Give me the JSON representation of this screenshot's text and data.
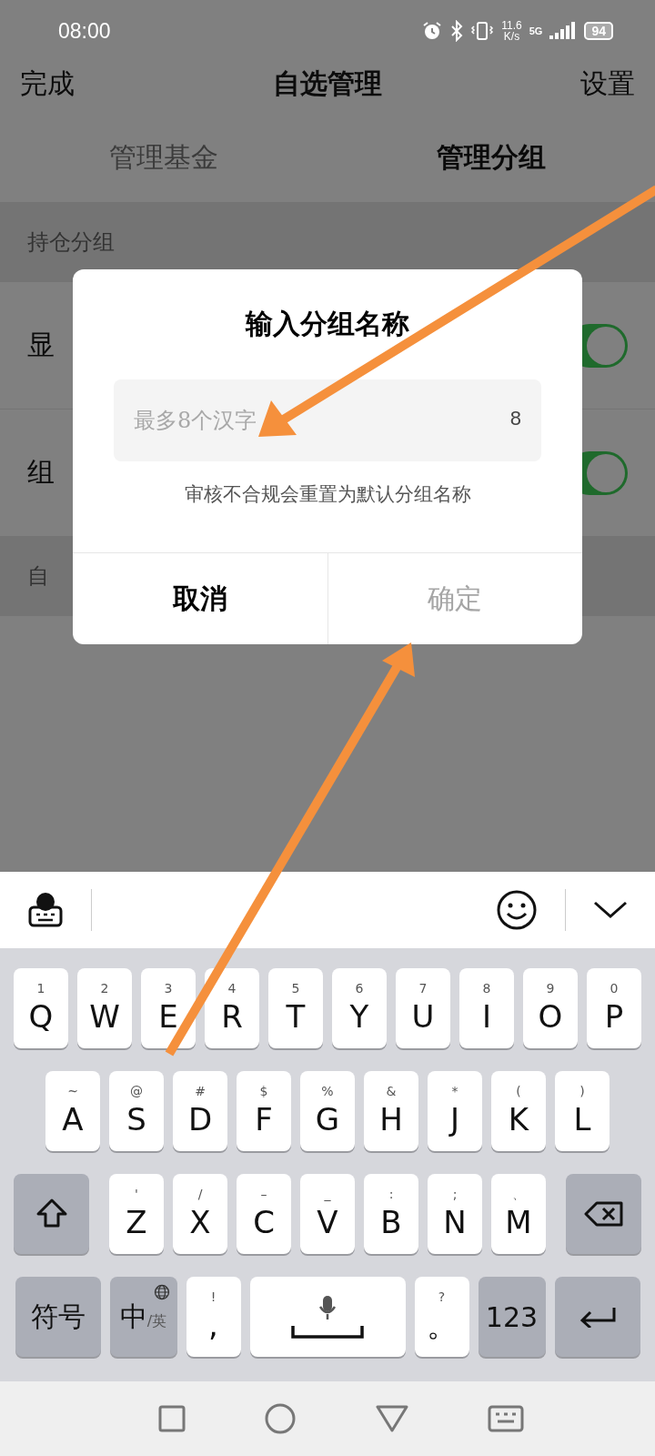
{
  "status_bar": {
    "time": "08:00",
    "net_speed": "11.6",
    "net_unit": "K/s",
    "network": "5G",
    "battery": "94"
  },
  "header": {
    "left": "完成",
    "title": "自选管理",
    "right": "设置"
  },
  "tabs": [
    {
      "label": "管理基金",
      "selected": false
    },
    {
      "label": "管理分组",
      "selected": true
    }
  ],
  "sections": [
    {
      "title": "持仓分组",
      "rows": [
        {
          "label": "显",
          "on": true
        },
        {
          "label": "组",
          "on": true
        }
      ]
    },
    {
      "title": "自"
    }
  ],
  "dialog": {
    "title": "输入分组名称",
    "field": {
      "placeholder": "最多8个汉字",
      "counter": "8"
    },
    "hint": "审核不合规会重置为默认分组名称",
    "buttons": [
      {
        "label": "取消",
        "disabled": false
      },
      {
        "label": "确定",
        "disabled": true
      }
    ]
  },
  "keyboard": {
    "rows": [
      {
        "keys": [
          {
            "kind": "letter",
            "hint": "1",
            "label": "Q"
          },
          {
            "kind": "letter",
            "hint": "2",
            "label": "W"
          },
          {
            "kind": "letter",
            "hint": "3",
            "label": "E"
          },
          {
            "kind": "letter",
            "hint": "4",
            "label": "R"
          },
          {
            "kind": "letter",
            "hint": "5",
            "label": "T"
          },
          {
            "kind": "letter",
            "hint": "6",
            "label": "Y"
          },
          {
            "kind": "letter",
            "hint": "7",
            "label": "U"
          },
          {
            "kind": "letter",
            "hint": "8",
            "label": "I"
          },
          {
            "kind": "letter",
            "hint": "9",
            "label": "O"
          },
          {
            "kind": "letter",
            "hint": "0",
            "label": "P"
          }
        ]
      },
      {
        "keys": [
          {
            "kind": "letter",
            "hint": "~",
            "label": "A"
          },
          {
            "kind": "letter",
            "hint": "@",
            "label": "S"
          },
          {
            "kind": "letter",
            "hint": "#",
            "label": "D"
          },
          {
            "kind": "letter",
            "hint": "$",
            "label": "F"
          },
          {
            "kind": "letter",
            "hint": "%",
            "label": "G"
          },
          {
            "kind": "letter",
            "hint": "&",
            "label": "H"
          },
          {
            "kind": "letter",
            "hint": "*",
            "label": "J"
          },
          {
            "kind": "letter",
            "hint": "(",
            "label": "K"
          },
          {
            "kind": "letter",
            "hint": ")",
            "label": "L"
          }
        ]
      },
      {
        "keys": [
          {
            "kind": "shift"
          },
          {
            "kind": "letter",
            "hint": "'",
            "label": "Z"
          },
          {
            "kind": "letter",
            "hint": "/",
            "label": "X"
          },
          {
            "kind": "letter",
            "hint": "–",
            "label": "C"
          },
          {
            "kind": "letter",
            "hint": "_",
            "label": "V"
          },
          {
            "kind": "letter",
            "hint": ":",
            "label": "B"
          },
          {
            "kind": "letter",
            "hint": ";",
            "label": "N"
          },
          {
            "kind": "letter",
            "hint": "、",
            "label": "M"
          },
          {
            "kind": "backspace"
          }
        ]
      },
      {
        "keys": [
          {
            "kind": "symbols",
            "label": "符号"
          },
          {
            "kind": "lang",
            "label": "中",
            "sub": "/英"
          },
          {
            "kind": "punct",
            "hint": "!",
            "label": ","
          },
          {
            "kind": "space"
          },
          {
            "kind": "punct",
            "hint": "?",
            "label": "。"
          },
          {
            "kind": "numbers",
            "label": "123"
          },
          {
            "kind": "enter"
          }
        ]
      }
    ]
  }
}
